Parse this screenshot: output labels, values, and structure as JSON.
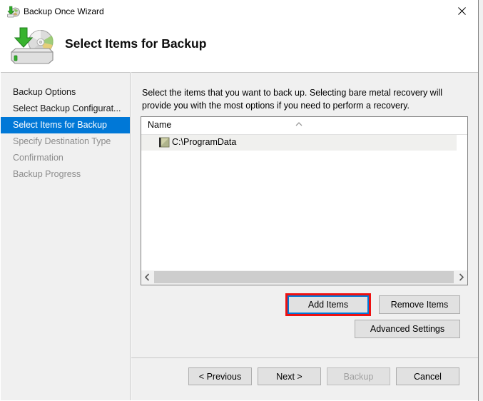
{
  "window": {
    "title": "Backup Once Wizard",
    "title_icon": "backup-disc-icon",
    "close_label": "×"
  },
  "header": {
    "title": "Select Items for Backup",
    "icon": "hard-drive-disc-backup-icon"
  },
  "sidebar": {
    "items": [
      {
        "label": "Backup Options",
        "state": "done"
      },
      {
        "label": "Select Backup Configurat...",
        "state": "done"
      },
      {
        "label": "Select Items for Backup",
        "state": "active"
      },
      {
        "label": "Specify Destination Type",
        "state": "future"
      },
      {
        "label": "Confirmation",
        "state": "future"
      },
      {
        "label": "Backup Progress",
        "state": "future"
      }
    ]
  },
  "main": {
    "instruction": "Select the items that you want to back up. Selecting bare metal recovery will provide you with the most options if you need to perform a recovery.",
    "list": {
      "column_header": "Name",
      "sort_indicator": "sort-ascending-chevron-icon",
      "rows": [
        {
          "label": "C:\\ProgramData",
          "icon": "folder-icon"
        }
      ],
      "hscroll": {
        "left_arrow": "‹",
        "right_arrow": "›"
      }
    },
    "buttons": {
      "add_items": "Add Items",
      "remove_items": "Remove Items",
      "advanced_settings": "Advanced Settings"
    }
  },
  "footer": {
    "previous": "< Previous",
    "next": "Next >",
    "backup": "Backup",
    "cancel": "Cancel"
  },
  "colors": {
    "accent": "#0078d7",
    "annotation": "#ee1111",
    "panel": "#f0f0f0",
    "button_face": "#e1e1e1"
  }
}
